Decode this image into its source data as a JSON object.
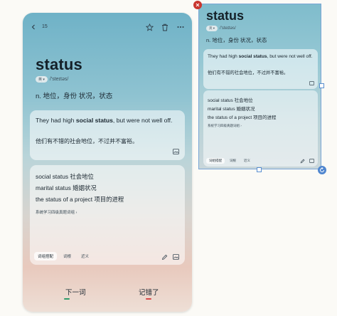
{
  "left_card": {
    "count": "15",
    "word": "status",
    "phonetic_badge": "英 ▾",
    "phonetic": "/'steɪtəs/",
    "definition": "n. 地位，身份   状况，状态",
    "example_en_parts": [
      "They had high ",
      "social status",
      ", but were not well off."
    ],
    "example_zh": "他们有不错的社会地位，不过并不富裕。",
    "phrases": [
      "social status  社会地位",
      "marital status  婚姻状况",
      "the status of a project  项目的进程"
    ],
    "phrase_link": "系统学习四级真题词组 ›",
    "tabs": [
      "词组搭配",
      "词根",
      "近义"
    ],
    "btn_next": "下一词",
    "btn_forgot": "记错了"
  },
  "preview_panel": {
    "word": "status",
    "phonetic_badge": "英 ▾",
    "phonetic": "/'steɪtəs/",
    "definition": "n. 地位，身份   状况，状态",
    "example_en_parts": [
      "They had high ",
      "social status",
      ", but were not well off."
    ],
    "example_zh": "他们有不错的社会地位，不过并不富裕。",
    "phrases": [
      "social status  社会地位",
      "marital status  婚姻状况",
      "the status of a project  项目的进程"
    ],
    "phrase_link": "系统学习四级真题词组 ›",
    "tabs": [
      "词组搭配",
      "词根",
      "近义"
    ]
  },
  "colors": {
    "next_dash": "#2e9c6a",
    "forgot_dash": "#d64747",
    "selection": "#5b8fd0",
    "close": "#c9362f"
  }
}
